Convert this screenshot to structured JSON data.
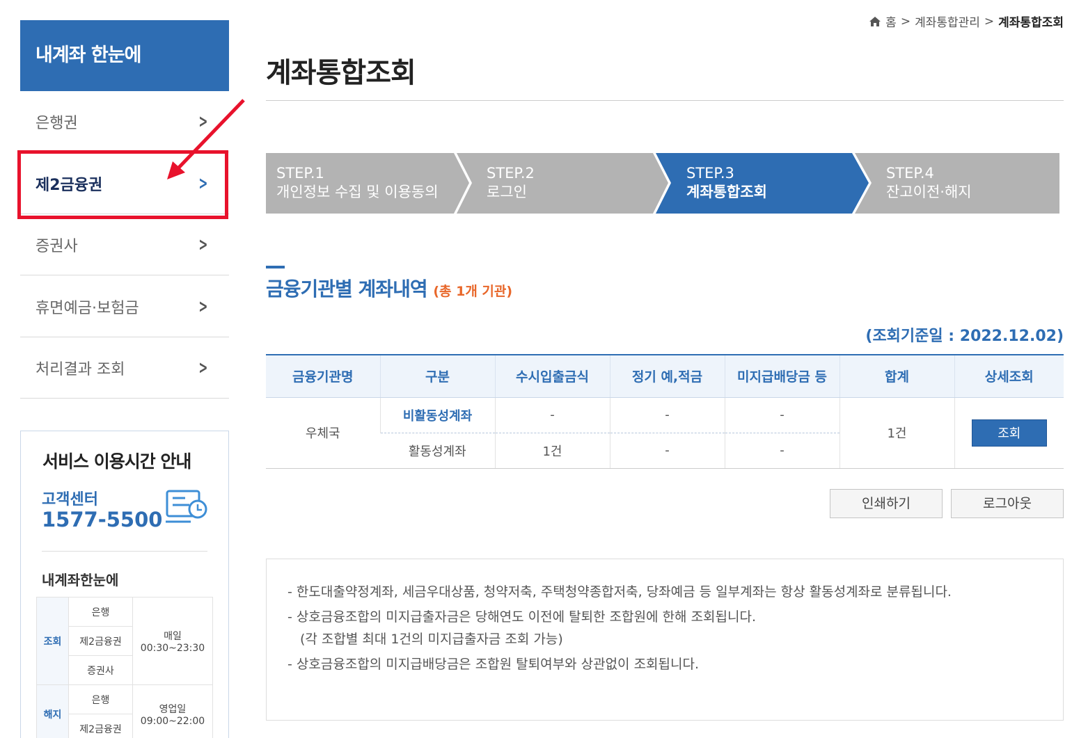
{
  "sidebar": {
    "title": "내계좌 한눈에",
    "items": [
      {
        "label": "은행권"
      },
      {
        "label": "제2금융권"
      },
      {
        "label": "증권사"
      },
      {
        "label": "휴면예금·보험금"
      },
      {
        "label": "처리결과 조회"
      }
    ]
  },
  "service": {
    "title": "서비스 이용시간 안내",
    "center_label": "고객센터",
    "phone": "1577-5500",
    "sub_title": "내계좌한눈에",
    "rows": {
      "lookup_label": "조회",
      "cancel_label": "해지",
      "bank": "은행",
      "second": "제2금융권",
      "securities": "증권사",
      "lookup_time_1": "매일",
      "lookup_time_2": "00:30~23:30",
      "cancel_time_1": "영업일",
      "cancel_time_2": "09:00~22:00"
    }
  },
  "breadcrumb": {
    "home": "홈",
    "mid": "계좌통합관리",
    "current": "계좌통합조회"
  },
  "page_title": "계좌통합조회",
  "steps": [
    {
      "step": "STEP.1",
      "label": "개인정보 수집 및 이용동의"
    },
    {
      "step": "STEP.2",
      "label": "로그인"
    },
    {
      "step": "STEP.3",
      "label": "계좌통합조회"
    },
    {
      "step": "STEP.4",
      "label": "잔고이전·해지"
    }
  ],
  "section": {
    "title": "금융기관별 계좌내역",
    "count": "(총 1개 기관)",
    "ref_date": "(조회기준일 : 2022.12.02)"
  },
  "table": {
    "headers": [
      "금융기관명",
      "구분",
      "수시입출금식",
      "정기 예,적금",
      "미지급배당금 등",
      "합계",
      "상세조회"
    ],
    "institution": "우체국",
    "row1": {
      "type": "비활동성계좌",
      "c1": "-",
      "c2": "-",
      "c3": "-"
    },
    "row2": {
      "type": "활동성계좌",
      "c1": "1건",
      "c2": "-",
      "c3": "-"
    },
    "total": "1건",
    "view_label": "조회"
  },
  "buttons": {
    "print": "인쇄하기",
    "logout": "로그아웃"
  },
  "notes": [
    "- 한도대출약정계좌, 세금우대상품, 청약저축, 주택청약종합저축, 당좌예금 등 일부계좌는 항상 활동성계좌로 분류됩니다.",
    "- 상호금융조합의 미지급출자금은 당해연도 이전에 탈퇴한 조합원에 한해 조회됩니다.",
    "(각 조합별 최대 1건의 미지급출자금 조회 가능)",
    "- 상호금융조합의 미지급배당금은 조합원 탈퇴여부와 상관없이 조회됩니다."
  ],
  "colors": {
    "accent": "#2e6db3",
    "highlight": "#e8122c",
    "step_inactive": "#b3b3b3"
  }
}
